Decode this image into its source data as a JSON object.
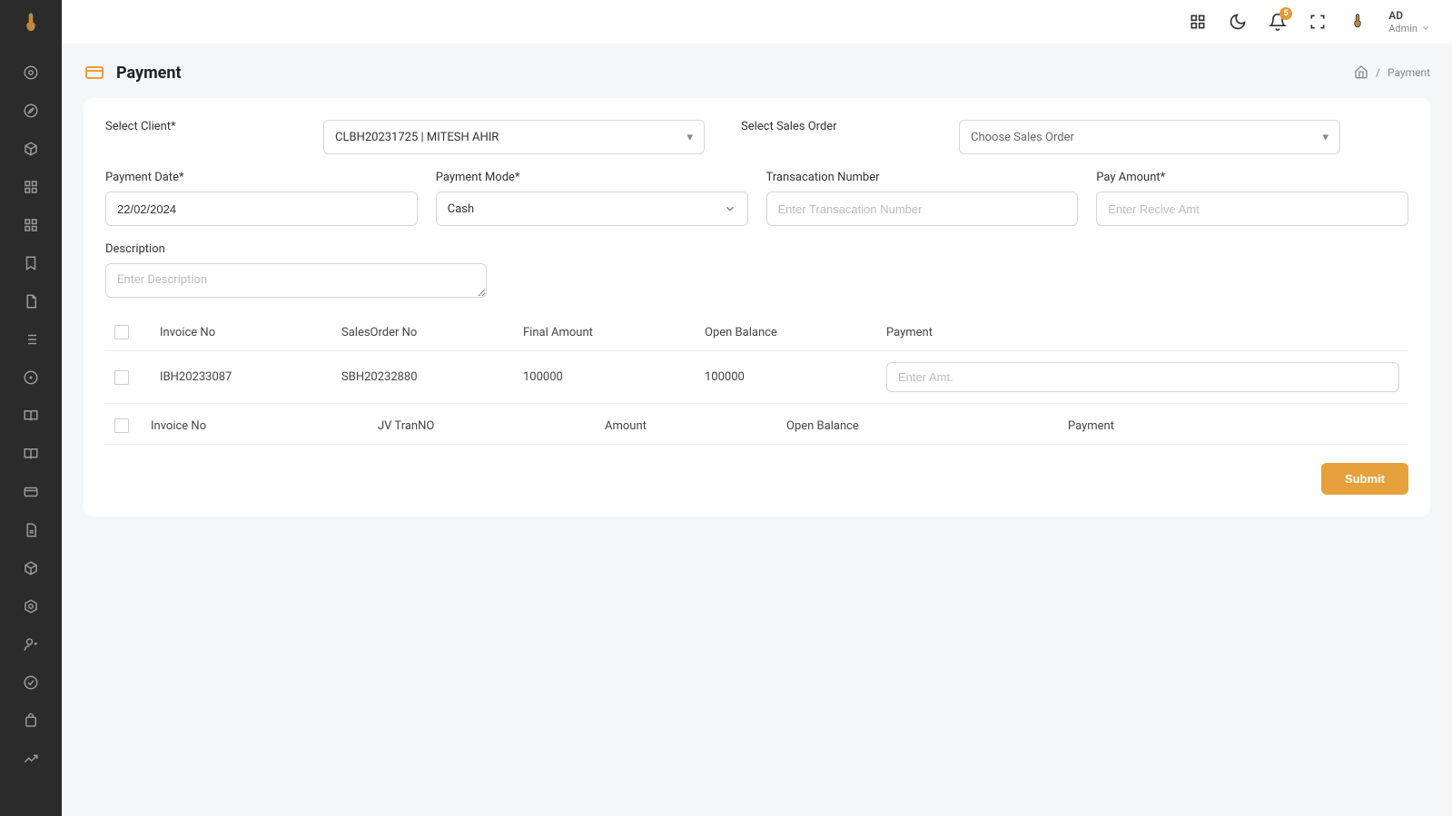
{
  "page": {
    "title": "Payment",
    "breadcrumb": {
      "sep": "/",
      "current": "Payment"
    }
  },
  "topbar": {
    "notification_count": "5",
    "user": {
      "initials": "AD",
      "role": "Admin"
    }
  },
  "form": {
    "select_client": {
      "label": "Select Client*",
      "value": "CLBH20231725 | MITESH AHIR"
    },
    "select_sales_order": {
      "label": "Select Sales Order",
      "value": "Choose Sales Order"
    },
    "payment_date": {
      "label": "Payment Date*",
      "value": "22/02/2024"
    },
    "payment_mode": {
      "label": "Payment Mode*",
      "value": "Cash"
    },
    "transaction_number": {
      "label": "Transacation Number",
      "placeholder": "Enter Transacation Number"
    },
    "pay_amount": {
      "label": "Pay Amount*",
      "placeholder": "Enter Recive Amt"
    },
    "description": {
      "label": "Description",
      "placeholder": "Enter Description"
    }
  },
  "table1": {
    "headers": {
      "invoice_no": "Invoice No",
      "salesorder_no": "SalesOrder No",
      "final_amount": "Final Amount",
      "open_balance": "Open Balance",
      "payment": "Payment"
    },
    "rows": [
      {
        "invoice_no": "IBH20233087",
        "salesorder_no": "SBH20232880",
        "final_amount": "100000",
        "open_balance": "100000",
        "payment_placeholder": "Enter Amt."
      }
    ]
  },
  "table2": {
    "headers": {
      "invoice_no": "Invoice No",
      "jv_tranno": "JV TranNO",
      "amount": "Amount",
      "open_balance": "Open Balance",
      "payment": "Payment"
    }
  },
  "buttons": {
    "submit": "Submit"
  }
}
